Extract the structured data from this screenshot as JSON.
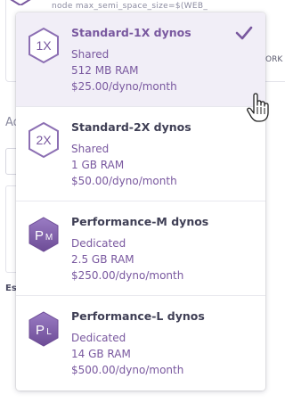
{
  "background": {
    "top_text": "node    max_semi_space_size=$(WEB_",
    "right_text": "ORK",
    "left_label": "Ad",
    "left_bold": "Es"
  },
  "dropdown": {
    "options": [
      {
        "badge": "1X",
        "name": "Standard-1X dynos",
        "type": "Shared",
        "ram": "512 MB RAM",
        "price": "$25.00/dyno/month",
        "selected": true
      },
      {
        "badge": "2X",
        "name": "Standard-2X dynos",
        "type": "Shared",
        "ram": "1 GB RAM",
        "price": "$50.00/dyno/month",
        "selected": false
      },
      {
        "badge": "PM",
        "name": "Performance-M dynos",
        "type": "Dedicated",
        "ram": "2.5 GB RAM",
        "price": "$250.00/dyno/month",
        "selected": false
      },
      {
        "badge": "PL",
        "name": "Performance-L dynos",
        "type": "Dedicated",
        "ram": "14 GB RAM",
        "price": "$500.00/dyno/month",
        "selected": false
      }
    ]
  },
  "colors": {
    "accent": "#79589f",
    "selected_bg": "#f1eef7",
    "text_dark": "#3f3f55"
  },
  "icons": [
    "hexagon-1x-icon",
    "hexagon-2x-icon",
    "performance-m-icon",
    "performance-l-icon",
    "checkmark-icon",
    "hand-pointer-cursor"
  ]
}
